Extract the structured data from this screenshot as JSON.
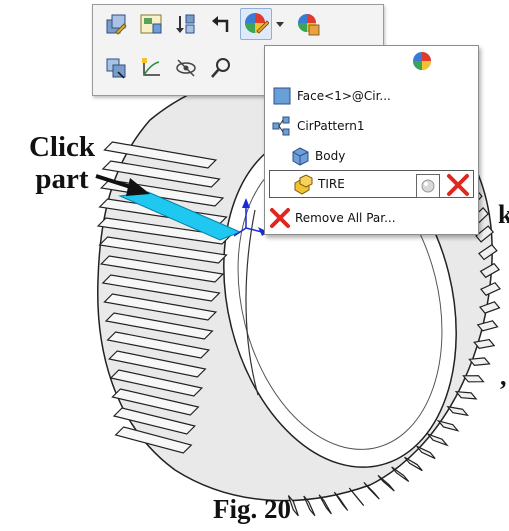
{
  "callout": {
    "line1": "Click",
    "line2": "part"
  },
  "figure_label": "Fig. 20",
  "edge_text": {
    "right_top": "k",
    "right_mid": ","
  },
  "toolbar": {
    "row1": [
      "edit-part-icon",
      "insert-component-icon",
      "sort-icon",
      "back-arrow-icon",
      "appearance-icon",
      "dropdown-chevron-icon",
      "appearance-alt-icon"
    ],
    "row2": [
      "move-component-icon",
      "sketch-icon",
      "hide-icon",
      "zoom-to-selection-icon"
    ]
  },
  "dropdown": {
    "items": [
      {
        "label": "Face<1>@Cir...",
        "icon": "face-icon"
      },
      {
        "label": "CirPattern1",
        "icon": "pattern-icon"
      },
      {
        "label": "Body",
        "icon": "body-icon"
      },
      {
        "label": "TIRE",
        "icon": "part-icon",
        "selected": true
      },
      {
        "label": "Remove All Par...",
        "icon": "delete-icon"
      }
    ]
  },
  "colors": {
    "selected_face": "#1ec8f0",
    "toolbar_bg": "#f3f3f3",
    "delete_red": "#e0271f",
    "part_yellow": "#f2c230"
  }
}
